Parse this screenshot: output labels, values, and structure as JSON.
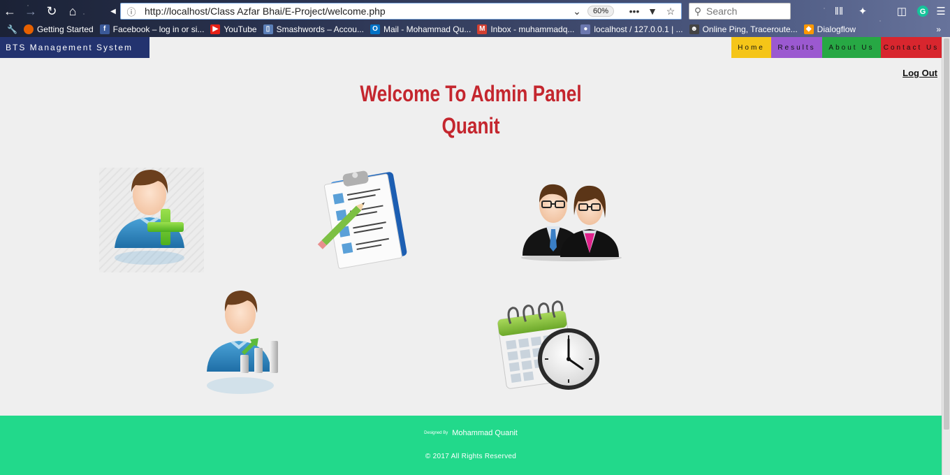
{
  "browser": {
    "url": "http://localhost/Class Azfar Bhai/E-Project/welcome.php",
    "zoom": "60%",
    "search_placeholder": "Search",
    "bookmarks": [
      {
        "label": "Getting Started",
        "color": "#e66000"
      },
      {
        "label": "Facebook – log in or si...",
        "color": "#3b5998"
      },
      {
        "label": "YouTube",
        "color": "#e62117"
      },
      {
        "label": "Smashwords – Accou...",
        "color": "#5b7fb8"
      },
      {
        "label": "Mail - Mohammad Qu...",
        "color": "#0072c6"
      },
      {
        "label": "Inbox - muhammadq...",
        "color": "#d23f31"
      },
      {
        "label": "localhost / 127.0.0.1 | ...",
        "color": "#6c78af"
      },
      {
        "label": "Online Ping, Traceroute...",
        "color": "#444444"
      },
      {
        "label": "Dialogflow",
        "color": "#ff9800"
      }
    ]
  },
  "site": {
    "brand": "BTS Management System",
    "nav": [
      {
        "label": "Home",
        "color": "#f5c518"
      },
      {
        "label": "Results",
        "color": "#9b59d0"
      },
      {
        "label": "About Us",
        "color": "#27a844"
      },
      {
        "label": "Contact Us",
        "color": "#d8262e"
      }
    ],
    "logout": "Log Out",
    "welcome_line1": "Welcome To Admin Panel",
    "welcome_line2": "Quanit",
    "tiles": [
      {
        "name": "add-user-icon"
      },
      {
        "name": "clipboard-list-icon"
      },
      {
        "name": "users-group-icon"
      },
      {
        "name": "user-stats-icon"
      },
      {
        "name": "calendar-clock-icon"
      }
    ],
    "footer": {
      "designed_prefix": "Designed By",
      "designer": "Mohammad Quanit",
      "copyright": "© 2017 All Rights Reserved",
      "bg_color": "#22d98b"
    }
  }
}
